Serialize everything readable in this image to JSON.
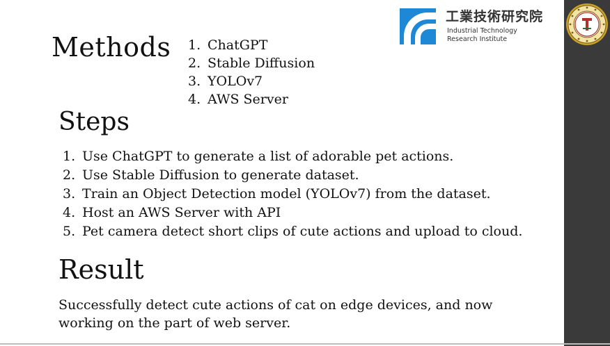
{
  "slide": {
    "methods": {
      "title": "Methods",
      "items": [
        {
          "num": "1.",
          "text": "ChatGPT"
        },
        {
          "num": "2.",
          "text": "Stable Diffusion"
        },
        {
          "num": "3.",
          "text": "YOLOv7"
        },
        {
          "num": "4.",
          "text": "AWS Server"
        }
      ]
    },
    "steps": {
      "title": "Steps",
      "items": [
        {
          "num": "1.",
          "text": "Use ChatGPT to generate a list of adorable pet actions."
        },
        {
          "num": "2.",
          "text": "Use Stable Diffusion to generate dataset."
        },
        {
          "num": "3.",
          "text": "Train an Object Detection model (YOLOv7) from the dataset."
        },
        {
          "num": "4.",
          "text": "Host an AWS Server with API"
        },
        {
          "num": "5.",
          "text": "Pet camera detect short clips of cute actions and upload to cloud."
        }
      ]
    },
    "result": {
      "title": "Result",
      "line1": "Successfully detect cute actions of cat on edge devices, and now",
      "line2": "working on the part of web server."
    }
  },
  "logo": {
    "name_zh": "工業技術研究院",
    "name_en_line1": "Industrial Technology",
    "name_en_line2": "Research Institute",
    "icon": "itri-logo-mark",
    "accent": "#1e88d6"
  },
  "seal": {
    "icon": "university-seal"
  },
  "colors": {
    "text": "#111111",
    "sidebar": "#3a3a3a",
    "seal_gold": "#c9a227",
    "seal_red": "#b0302a"
  }
}
